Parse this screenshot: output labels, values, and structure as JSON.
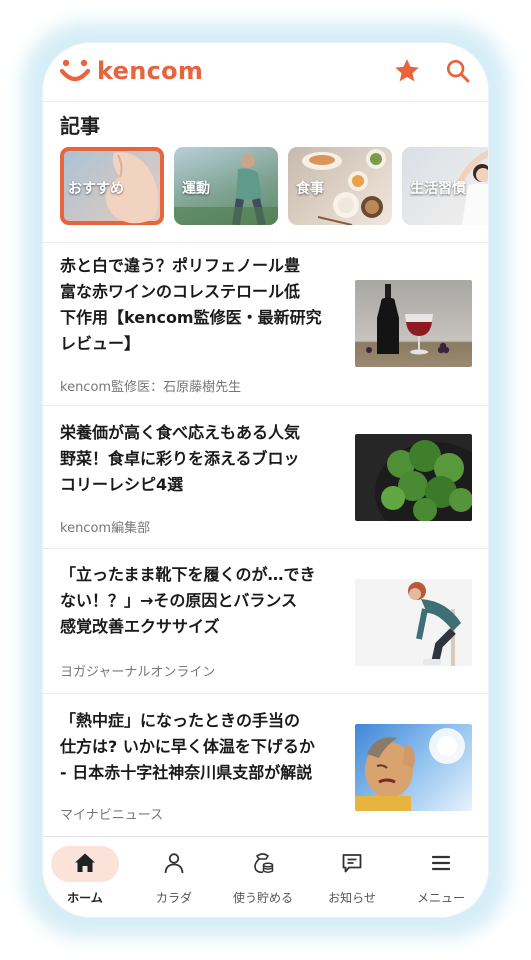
{
  "header": {
    "logo_text": "kencom",
    "favorite_icon": "star-icon",
    "search_icon": "search-icon",
    "accent_color": "#e8643c"
  },
  "section": {
    "title": "記事"
  },
  "categories": [
    {
      "label": "おすすめ",
      "active": true
    },
    {
      "label": "運動",
      "active": false
    },
    {
      "label": "食事",
      "active": false
    },
    {
      "label": "生活習慣",
      "active": false
    }
  ],
  "articles": [
    {
      "title": [
        "赤と白で違う？ポリフェノール豊",
        "富な赤ワインのコレステロール低",
        "下作用【kencom監修医・最新研究",
        "レビュー】"
      ],
      "source": "kencom監修医：石原藤樹先生"
    },
    {
      "title": [
        "栄養価が高く食べ応えもある人気",
        "野菜！食卓に彩りを添えるブロッ",
        "コリーレシピ4選"
      ],
      "source": "kencom編集部"
    },
    {
      "title": [
        "「立ったまま靴下を履くのが…でき",
        "ない！？」→その原因とバランス",
        "感覚改善エクササイズ"
      ],
      "source": "ヨガジャーナルオンライン"
    },
    {
      "title": [
        "「熱中症」になったときの手当の",
        "仕方は? いかに早く体温を下げるか",
        "- 日本赤十字社神奈川県支部が解説"
      ],
      "source": "マイナビニュース"
    }
  ],
  "nav": [
    {
      "label": "ホーム",
      "icon": "home-icon",
      "active": true
    },
    {
      "label": "カラダ",
      "icon": "person-icon",
      "active": false
    },
    {
      "label": "使う貯める",
      "icon": "coins-icon",
      "active": false
    },
    {
      "label": "お知らせ",
      "icon": "message-icon",
      "active": false
    },
    {
      "label": "メニュー",
      "icon": "menu-icon",
      "active": false
    }
  ]
}
